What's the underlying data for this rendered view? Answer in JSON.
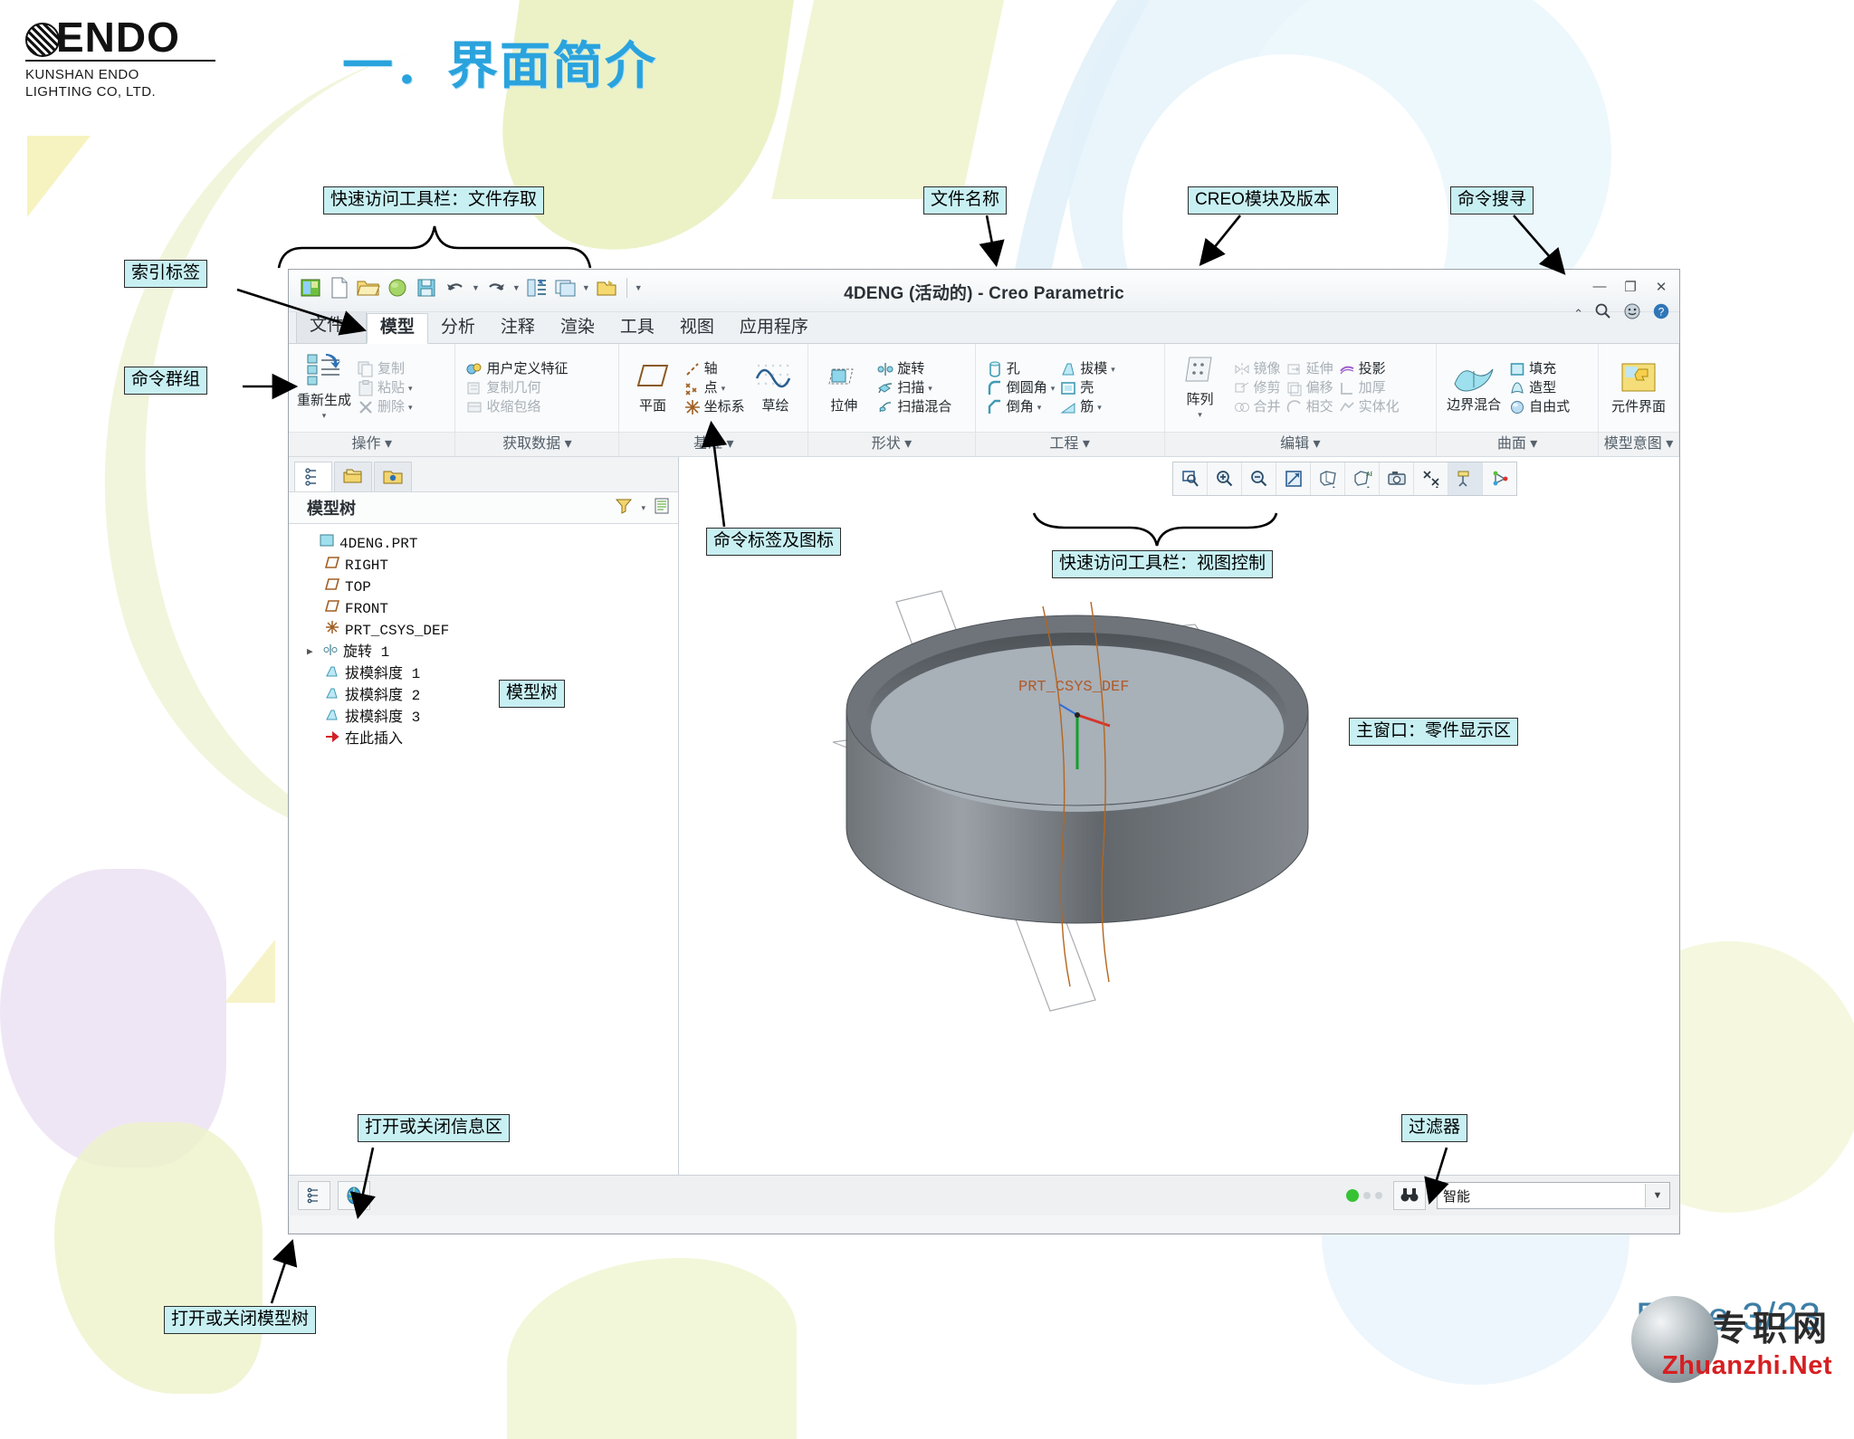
{
  "slide": {
    "title": "一．界面简介",
    "page_label": "Page  3/23",
    "logo": {
      "word": "ENDO",
      "line1": "KUNSHAN ENDO",
      "line2": "LIGHTING CO, LTD."
    },
    "watermark": {
      "cn": "专职网",
      "en": "Zhuanzhi.Net"
    }
  },
  "callouts": {
    "qat_file": "快速访问工具栏：文件存取",
    "file_name": "文件名称",
    "creo_module": "CREO模块及版本",
    "command_search": "命令搜寻",
    "index_tab": "索引标签",
    "command_group": "命令群组",
    "command_label_icon": "命令标签及图标",
    "qat_view": "快速访问工具栏：视图控制",
    "model_tree": "模型树",
    "main_window": "主窗口：零件显示区",
    "info_area": "打开或关闭信息区",
    "filter": "过滤器",
    "tree_toggle": "打开或关闭模型树"
  },
  "window": {
    "title": "4DENG (活动的) - Creo Parametric",
    "controls": {
      "minimize": "—",
      "restore": "❐",
      "close": "✕"
    },
    "help_icons": [
      "chevron-up-icon",
      "search-icon",
      "smiley-icon",
      "help-icon"
    ],
    "qat": [
      "creo-home-icon",
      "new-icon",
      "open-icon",
      "quick-save-icon",
      "save-icon",
      "undo-icon",
      "redo-icon",
      "regenerate-icon",
      "window-icon",
      "close-window-icon",
      "customize-icon"
    ]
  },
  "tabs": {
    "file": "文件",
    "items": [
      "模型",
      "分析",
      "注释",
      "渲染",
      "工具",
      "视图",
      "应用程序"
    ],
    "active": "模型"
  },
  "ribbon": {
    "groups": [
      {
        "label": "操作",
        "big": [
          {
            "label": "重新生成",
            "icon": "regenerate-icon",
            "dropdown": true
          }
        ],
        "cols": [
          [
            {
              "label": "复制",
              "icon": "copy-icon",
              "disabled": true,
              "dropdown": false
            },
            {
              "label": "粘贴",
              "icon": "paste-icon",
              "disabled": true,
              "dropdown": true
            },
            {
              "label": "删除",
              "icon": "delete-icon",
              "disabled": true,
              "dropdown": true
            }
          ]
        ]
      },
      {
        "label": "获取数据",
        "big": [],
        "cols": [
          [
            {
              "label": "用户定义特征",
              "icon": "udf-icon",
              "disabled": false,
              "dropdown": false
            },
            {
              "label": "复制几何",
              "icon": "copy-geometry-icon",
              "disabled": true,
              "dropdown": false
            },
            {
              "label": "收缩包络",
              "icon": "shrinkwrap-icon",
              "disabled": true,
              "dropdown": false
            }
          ]
        ]
      },
      {
        "label": "基准",
        "big": [
          {
            "label": "平面",
            "icon": "plane-icon",
            "dropdown": false
          }
        ],
        "cols": [
          [
            {
              "label": "轴",
              "icon": "axis-icon",
              "disabled": false,
              "dropdown": false
            },
            {
              "label": "点",
              "icon": "point-icon",
              "disabled": false,
              "dropdown": true
            },
            {
              "label": "坐标系",
              "icon": "csys-icon",
              "disabled": false,
              "dropdown": false
            }
          ]
        ],
        "big2": [
          {
            "label": "草绘",
            "icon": "sketch-icon",
            "dropdown": false
          }
        ]
      },
      {
        "label": "形状",
        "big": [
          {
            "label": "拉伸",
            "icon": "extrude-icon",
            "dropdown": false
          }
        ],
        "cols": [
          [
            {
              "label": "旋转",
              "icon": "revolve-icon",
              "disabled": false,
              "dropdown": false
            },
            {
              "label": "扫描",
              "icon": "sweep-icon",
              "disabled": false,
              "dropdown": true
            },
            {
              "label": "扫描混合",
              "icon": "swept-blend-icon",
              "disabled": false,
              "dropdown": false
            }
          ]
        ]
      },
      {
        "label": "工程",
        "big": [],
        "cols": [
          [
            {
              "label": "孔",
              "icon": "hole-icon",
              "disabled": false,
              "dropdown": false
            },
            {
              "label": "倒圆角",
              "icon": "round-icon",
              "disabled": false,
              "dropdown": true
            },
            {
              "label": "倒角",
              "icon": "chamfer-icon",
              "disabled": false,
              "dropdown": true
            }
          ],
          [
            {
              "label": "拔模",
              "icon": "draft-icon",
              "disabled": false,
              "dropdown": true
            },
            {
              "label": "壳",
              "icon": "shell-icon",
              "disabled": false,
              "dropdown": false
            },
            {
              "label": "筋",
              "icon": "rib-icon",
              "disabled": false,
              "dropdown": true
            }
          ]
        ]
      },
      {
        "label": "编辑",
        "big": [
          {
            "label": "阵列",
            "icon": "pattern-icon",
            "dropdown": true
          }
        ],
        "cols": [
          [
            {
              "label": "镜像",
              "icon": "mirror-icon",
              "disabled": true,
              "dropdown": false
            },
            {
              "label": "修剪",
              "icon": "trim-icon",
              "disabled": true,
              "dropdown": false
            },
            {
              "label": "合并",
              "icon": "merge-icon",
              "disabled": true,
              "dropdown": false
            }
          ],
          [
            {
              "label": "延伸",
              "icon": "extend-icon",
              "disabled": true,
              "dropdown": false
            },
            {
              "label": "偏移",
              "icon": "offset-icon",
              "disabled": true,
              "dropdown": false
            },
            {
              "label": "相交",
              "icon": "intersect-icon",
              "disabled": true,
              "dropdown": false
            }
          ],
          [
            {
              "label": "投影",
              "icon": "project-icon",
              "disabled": false,
              "dropdown": false
            },
            {
              "label": "加厚",
              "icon": "thicken-icon",
              "disabled": true,
              "dropdown": false
            },
            {
              "label": "实体化",
              "icon": "solidify-icon",
              "disabled": true,
              "dropdown": false
            }
          ]
        ]
      },
      {
        "label": "曲面",
        "big": [
          {
            "label": "边界混合",
            "icon": "boundary-blend-icon",
            "dropdown": false
          }
        ],
        "cols": [
          [
            {
              "label": "填充",
              "icon": "fill-icon",
              "disabled": false,
              "dropdown": false
            },
            {
              "label": "造型",
              "icon": "style-icon",
              "disabled": false,
              "dropdown": false
            },
            {
              "label": "自由式",
              "icon": "freestyle-icon",
              "disabled": false,
              "dropdown": false
            }
          ]
        ]
      },
      {
        "label": "模型意图",
        "big": [
          {
            "label": "元件界面",
            "icon": "component-interface-icon",
            "dropdown": false
          }
        ],
        "cols": []
      }
    ]
  },
  "tree": {
    "tabs": [
      "model-tree-icon",
      "layers-icon",
      "folder-browser-icon"
    ],
    "header": "模型树",
    "header_icons": [
      "filter-tree-icon",
      "tree-settings-icon"
    ],
    "nodes": [
      {
        "label": "4DENG.PRT",
        "icon": "part-icon",
        "level": 1,
        "expand": ""
      },
      {
        "label": "RIGHT",
        "icon": "datum-plane-icon",
        "level": 2,
        "expand": ""
      },
      {
        "label": "TOP",
        "icon": "datum-plane-icon",
        "level": 2,
        "expand": ""
      },
      {
        "label": "FRONT",
        "icon": "datum-plane-icon",
        "level": 2,
        "expand": ""
      },
      {
        "label": "PRT_CSYS_DEF",
        "icon": "csys-icon",
        "level": 2,
        "expand": ""
      },
      {
        "label": "旋转 1",
        "icon": "revolve-icon",
        "level": 2,
        "expand": "▶"
      },
      {
        "label": "拔模斜度 1",
        "icon": "draft-icon",
        "level": 2,
        "expand": ""
      },
      {
        "label": "拔模斜度 2",
        "icon": "draft-icon",
        "level": 2,
        "expand": ""
      },
      {
        "label": "拔模斜度 3",
        "icon": "draft-icon",
        "level": 2,
        "expand": ""
      },
      {
        "label": "在此插入",
        "icon": "insert-here-icon",
        "level": 2,
        "expand": ""
      }
    ]
  },
  "viewbar": {
    "buttons": [
      "refit-icon",
      "zoom-in-icon",
      "zoom-out-icon",
      "repaint-icon",
      "display-style-icon",
      "saved-views-icon",
      "view-manager-icon",
      "datum-display-icon",
      "annotation-display-icon",
      "spin-center-icon"
    ],
    "selected_index": 8
  },
  "model3d": {
    "csys_label": "PRT_CSYS_DEF"
  },
  "statusbar": {
    "left_icons": [
      "tree-toggle-icon",
      "browser-icon"
    ],
    "message": "",
    "selection_indicator": "●",
    "find_icon": "find-icon",
    "filter_value": "智能"
  }
}
